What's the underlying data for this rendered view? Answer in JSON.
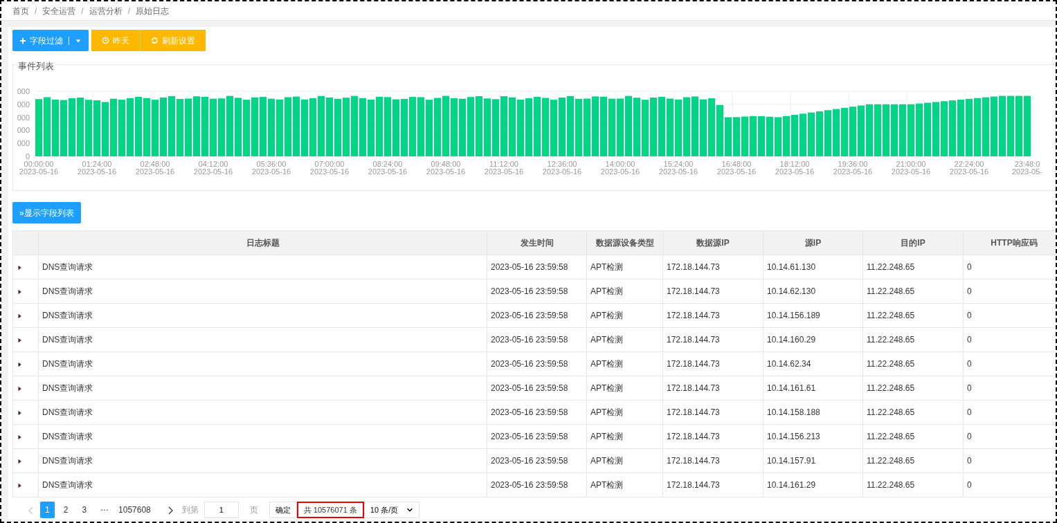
{
  "breadcrumb": [
    "首页",
    "安全运营",
    "运营分析",
    "原始日志"
  ],
  "breadcrumb_separator": "/",
  "toolbar": {
    "filter_button": "字段过滤",
    "quick_buttons": [
      "昨天",
      "刷新设置"
    ]
  },
  "chart_panel": {
    "legend": "事件列表",
    "y_tick_labels": [
      "000",
      "000",
      "000",
      "000",
      "000",
      "0"
    ],
    "x_tick_labels": [
      {
        "time": "00:00:00",
        "date": "2023-05-16"
      },
      {
        "time": "01:24:00",
        "date": "2023-05-16"
      },
      {
        "time": "02:48:00",
        "date": "2023-05-16"
      },
      {
        "time": "04:12:00",
        "date": "2023-05-16"
      },
      {
        "time": "05:36:00",
        "date": "2023-05-16"
      },
      {
        "time": "07:00:00",
        "date": "2023-05-16"
      },
      {
        "time": "08:24:00",
        "date": "2023-05-16"
      },
      {
        "time": "09:48:00",
        "date": "2023-05-16"
      },
      {
        "time": "11:12:00",
        "date": "2023-05-16"
      },
      {
        "time": "12:36:00",
        "date": "2023-05-16"
      },
      {
        "time": "14:00:00",
        "date": "2023-05-16"
      },
      {
        "time": "15:24:00",
        "date": "2023-05-16"
      },
      {
        "time": "16:48:00",
        "date": "2023-05-16"
      },
      {
        "time": "18:12:00",
        "date": "2023-05-16"
      },
      {
        "time": "19:36:00",
        "date": "2023-05-16"
      },
      {
        "time": "21:00:00",
        "date": "2023-05-16"
      },
      {
        "time": "22:24:00",
        "date": "2023-05-16"
      },
      {
        "time": "23:48:0",
        "date": "2023-05-"
      }
    ]
  },
  "show_fields_button": "»显示字段列表",
  "table": {
    "columns": [
      "日志标题",
      "发生时间",
      "数据源设备类型",
      "数据源IP",
      "源IP",
      "目的IP",
      "HTTP响应码"
    ],
    "rows": [
      {
        "expanded": false,
        "cells": [
          "DNS查询请求",
          "2023-05-16 23:59:58",
          "APT检测",
          "172.18.144.73",
          "10.14.61.130",
          "11.22.248.65",
          "0"
        ]
      },
      {
        "expanded": false,
        "cells": [
          "DNS查询请求",
          "2023-05-16 23:59:58",
          "APT检测",
          "172.18.144.73",
          "10.14.62.130",
          "11.22.248.65",
          "0"
        ]
      },
      {
        "expanded": false,
        "cells": [
          "DNS查询请求",
          "2023-05-16 23:59:58",
          "APT检测",
          "172.18.144.73",
          "10.14.156.189",
          "11.22.248.65",
          "0"
        ]
      },
      {
        "expanded": false,
        "cells": [
          "DNS查询请求",
          "2023-05-16 23:59:58",
          "APT检测",
          "172.18.144.73",
          "10.14.160.29",
          "11.22.248.65",
          "0"
        ]
      },
      {
        "expanded": false,
        "cells": [
          "DNS查询请求",
          "2023-05-16 23:59:58",
          "APT检测",
          "172.18.144.73",
          "10.14.62.34",
          "11.22.248.65",
          "0"
        ]
      },
      {
        "expanded": false,
        "cells": [
          "DNS查询请求",
          "2023-05-16 23:59:58",
          "APT检测",
          "172.18.144.73",
          "10.14.161.61",
          "11.22.248.65",
          "0"
        ]
      },
      {
        "expanded": false,
        "cells": [
          "DNS查询请求",
          "2023-05-16 23:59:58",
          "APT检测",
          "172.18.144.73",
          "10.14.158.188",
          "11.22.248.65",
          "0"
        ]
      },
      {
        "expanded": false,
        "cells": [
          "DNS查询请求",
          "2023-05-16 23:59:58",
          "APT检测",
          "172.18.144.73",
          "10.14.156.213",
          "11.22.248.65",
          "0"
        ]
      },
      {
        "expanded": false,
        "cells": [
          "DNS查询请求",
          "2023-05-16 23:59:58",
          "APT检测",
          "172.18.144.73",
          "10.14.157.91",
          "11.22.248.65",
          "0"
        ]
      },
      {
        "expanded": false,
        "cells": [
          "DNS查询请求",
          "2023-05-16 23:59:58",
          "APT检测",
          "172.18.144.73",
          "10.14.161.29",
          "11.22.248.65",
          "0"
        ]
      }
    ]
  },
  "pagination": {
    "pages": [
      {
        "label": "1",
        "selected": true
      },
      {
        "label": "2",
        "selected": false
      },
      {
        "label": "3",
        "selected": false
      }
    ],
    "ellipsis": "…",
    "last_page": "1057608",
    "goto_label": "到第",
    "goto_value": "1",
    "page_unit": "页",
    "confirm": "确定",
    "total": "共 10576071 条",
    "total_highlighted": true,
    "page_size": "10 条/页"
  }
}
